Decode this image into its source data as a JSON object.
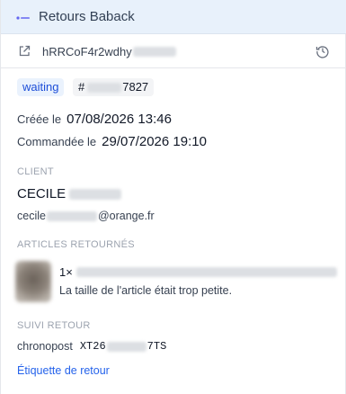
{
  "header": {
    "title": "Retours Baback",
    "accent": "#6366f1",
    "icon": "app-logo-icon"
  },
  "order": {
    "id_visible": "hRRCoF4r2wdhy",
    "external_icon": "external-link-icon",
    "history_icon": "history-icon"
  },
  "status": {
    "label": "waiting",
    "ref_prefix": "#",
    "ref_suffix": "7827"
  },
  "dates": {
    "created_label": "Créée le",
    "created_value": "07/08/2026 13:46",
    "ordered_label": "Commandée le",
    "ordered_value": "29/07/2026 19:10"
  },
  "client": {
    "section": "CLIENT",
    "first_name": "CECILE",
    "email_prefix": "cecile",
    "email_domain": "@orange.fr"
  },
  "articles": {
    "section": "ARTICLES RETOURNÉS",
    "items": [
      {
        "quantity": "1×",
        "reason": "La taille de l'article était trop petite."
      }
    ]
  },
  "tracking": {
    "section": "SUIVI RETOUR",
    "carrier": "chronopost",
    "code_prefix": "XT26",
    "code_suffix": "7TS",
    "link_label": "Étiquette de retour"
  }
}
